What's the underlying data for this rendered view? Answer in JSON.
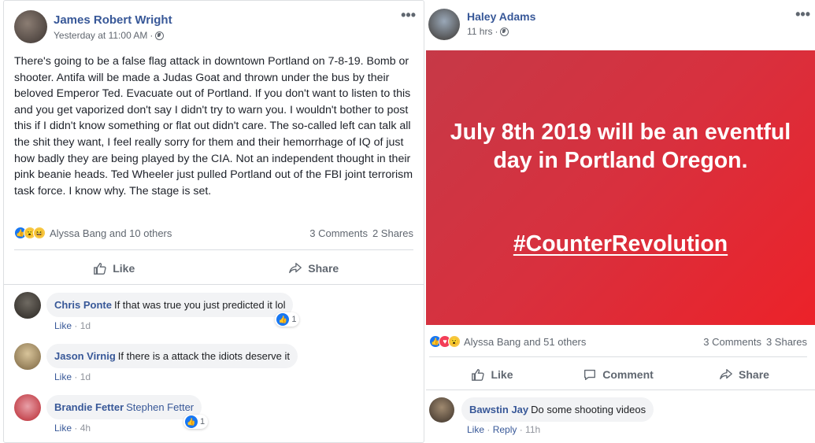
{
  "post1": {
    "author": "James Robert Wright",
    "timestamp": "Yesterday at 11:00 AM",
    "more": "•••",
    "text": "There's going to be a false flag attack in downtown Portland on 7-8-19. Bomb or shooter. Antifa will be made a Judas Goat and thrown under the bus by their beloved Emperor Ted. Evacuate out of Portland. If you don't want to listen to this and you get vaporized don't say I didn't try to warn you. I wouldn't bother to post this if I didn't know something or flat out didn't care. The so-called left can talk all the shit they want, I feel really sorry for them and their hemorrhage of IQ of just how badly they are being played by the CIA. Not an independent thought in their pink beanie heads. Ted Wheeler just pulled Portland out of the FBI joint terrorism task force. I know why. The stage is set.",
    "reactions_label": "Alyssa Bang and 10 others",
    "comments_count": "3 Comments",
    "shares_count": "2 Shares",
    "like_label": "Like",
    "share_label": "Share",
    "comments": [
      {
        "name": "Chris Ponte",
        "text": "If that was true you just predicted it lol",
        "like": "Like",
        "time": "1d",
        "reacts": "1"
      },
      {
        "name": "Jason Virnig",
        "text": "If there is a attack the idiots deserve it",
        "like": "Like",
        "time": "1d"
      },
      {
        "name": "Brandie Fetter",
        "tag": "Stephen Fetter",
        "like": "Like",
        "time": "4h",
        "reacts": "1"
      }
    ]
  },
  "post2": {
    "author": "Haley Adams",
    "timestamp": "11 hrs",
    "more": "•••",
    "card_headline": "July 8th 2019 will be an eventful day in Portland Oregon.",
    "card_hashtag": "#CounterRevolution",
    "card_colors": [
      "#c63947",
      "#ec2229"
    ],
    "reactions_label": "Alyssa Bang and 51 others",
    "comments_count": "3 Comments",
    "shares_count": "3 Shares",
    "like_label": "Like",
    "comment_label": "Comment",
    "share_label": "Share",
    "comments": [
      {
        "name": "Bawstin Jay",
        "text": "Do some shooting videos",
        "like": "Like",
        "reply": "Reply",
        "time": "11h"
      }
    ]
  }
}
